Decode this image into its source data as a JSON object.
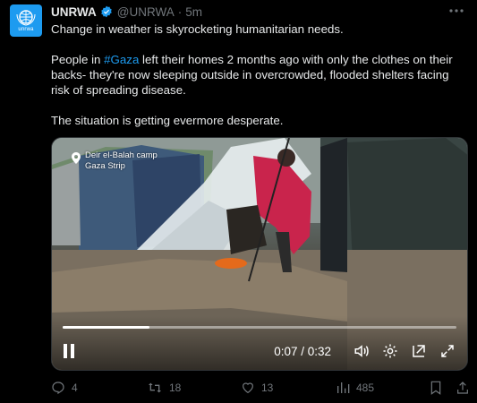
{
  "tweet": {
    "author_name": "UNRWA",
    "handle": "@UNRWA",
    "separator": "·",
    "time": "5m",
    "avatar_caption": "unrwa",
    "lines": {
      "l1": "Change in weather is skyrocketing humanitarian needs.",
      "l2_pre": "People in ",
      "hashtag": "#Gaza",
      "l2_post": " left their homes 2 months ago with only the clothes on their backs- they're now sleeping outside in overcrowded, flooded shelters facing risk of spreading disease.",
      "l3": "The situation is getting evermore desperate."
    }
  },
  "video": {
    "location_line1": "Deir el-Balah camp",
    "location_line2": "Gaza Strip",
    "current_time": "0:07",
    "duration": "0:32",
    "time_display": "0:07 / 0:32",
    "progress_fraction": 0.22
  },
  "actions": {
    "replies": "4",
    "reposts": "18",
    "likes": "13",
    "views": "485"
  },
  "icons": [
    "verified-icon",
    "more-icon",
    "location-pin-icon",
    "play-icon",
    "volume-icon",
    "settings-icon",
    "pip-icon",
    "fullscreen-icon",
    "reply-icon",
    "repost-icon",
    "like-icon",
    "views-icon",
    "bookmark-icon",
    "share-icon"
  ],
  "colors": {
    "accent": "#1d9bf0",
    "background": "#000000",
    "muted": "#71767b",
    "text": "#e7e9ea"
  }
}
